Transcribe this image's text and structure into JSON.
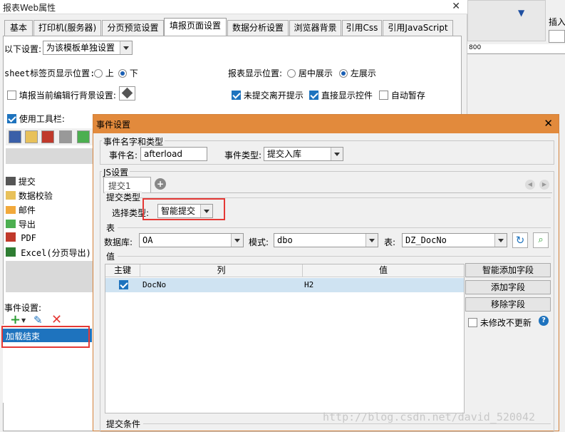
{
  "outer": {
    "title": "报表Web属性",
    "tabs": [
      "基本",
      "打印机(服务器)",
      "分页预览设置",
      "填报页面设置",
      "数据分析设置",
      "浏览器背景",
      "引用Css",
      "引用JavaScript"
    ],
    "settings_label": "以下设置:",
    "settings_value": "为该模板单独设置",
    "sheet_pos_label": "sheet标签页显示位置:",
    "sheet_top": "上",
    "sheet_bottom": "下",
    "report_pos_label": "报表显示位置:",
    "report_center": "居中展示",
    "report_left": "左展示",
    "fill_bg_label": "填报当前编辑行背景设置:",
    "no_submit_leave": "未提交离开提示",
    "direct_show": "直接显示控件",
    "auto_save": "自动暂存",
    "use_toolbar": "使用工具栏:",
    "toolbar_items": [
      "提交",
      "数据校验",
      "邮件",
      "导出",
      "PDF",
      "Excel(分页导出)"
    ],
    "event_settings": "事件设置:",
    "event_item": "加载结束",
    "ruler": "800"
  },
  "right": {
    "label": "插入"
  },
  "inner": {
    "title": "事件设置",
    "name_type_group": "事件名字和类型",
    "event_name_label": "事件名:",
    "event_name_value": "afterload",
    "event_type_label": "事件类型:",
    "event_type_value": "提交入库",
    "js_group": "JS设置",
    "js_tab": "提交1",
    "submit_type_group": "提交类型",
    "select_type_label": "选择类型:",
    "select_type_value": "智能提交",
    "table_group": "表",
    "db_label": "数据库:",
    "db_value": "OA",
    "schema_label": "模式:",
    "schema_value": "dbo",
    "table_label": "表:",
    "table_value": "DZ_DocNo",
    "value_group": "值",
    "grid_headers": [
      "主键",
      "列",
      "值"
    ],
    "grid_row": {
      "key": true,
      "column": "DocNo",
      "value": "H2"
    },
    "btn_smart_add": "智能添加字段",
    "btn_add": "添加字段",
    "btn_remove": "移除字段",
    "not_modified": "未修改不更新",
    "submit_condition": "提交条件",
    "watermark": "http://blog.csdn.net/david_520042"
  }
}
